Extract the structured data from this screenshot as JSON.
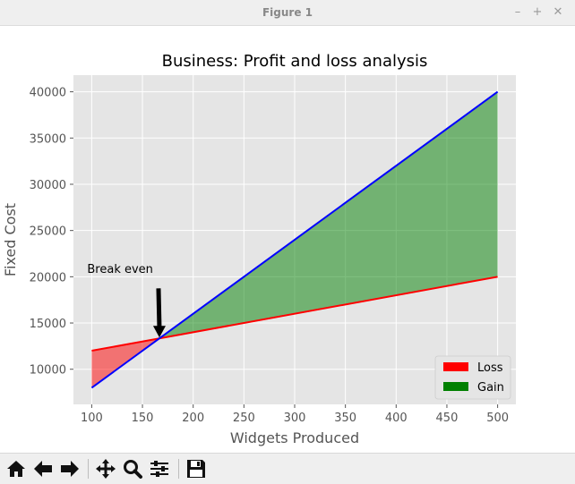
{
  "window": {
    "title": "Figure 1",
    "controls": [
      "minimize",
      "maximize",
      "close"
    ]
  },
  "toolbar": {
    "buttons": [
      {
        "name": "home-button",
        "icon": "home-icon"
      },
      {
        "name": "back-button",
        "icon": "arrow-left-icon"
      },
      {
        "name": "forward-button",
        "icon": "arrow-right-icon"
      },
      {
        "name": "pan-button",
        "icon": "move-icon"
      },
      {
        "name": "zoom-button",
        "icon": "magnifier-icon"
      },
      {
        "name": "configure-subplots-button",
        "icon": "sliders-icon"
      },
      {
        "name": "save-button",
        "icon": "floppy-disk-icon"
      }
    ]
  },
  "chart_data": {
    "type": "line",
    "title": "Business: Profit and loss analysis",
    "xlabel": "Widgets Produced",
    "ylabel": "Fixed Cost",
    "xlim": [
      82,
      518
    ],
    "ylim": [
      6200,
      41800
    ],
    "xticks": [
      100,
      150,
      200,
      250,
      300,
      350,
      400,
      450,
      500
    ],
    "yticks": [
      10000,
      15000,
      20000,
      25000,
      30000,
      35000,
      40000
    ],
    "grid": true,
    "series": [
      {
        "name": "",
        "color": "#ff0000",
        "x": [
          100,
          500
        ],
        "y": [
          12000,
          20000
        ]
      },
      {
        "name": "",
        "color": "#0000ff",
        "x": [
          100,
          500
        ],
        "y": [
          8000,
          40000
        ]
      }
    ],
    "fills": [
      {
        "name": "Loss",
        "color": "#ff0000",
        "x_from": 100,
        "x_to": 166.7
      },
      {
        "name": "Gain",
        "color": "#008000",
        "x_from": 166.7,
        "x_to": 500
      }
    ],
    "legend": {
      "position": "bottom-right",
      "entries": [
        {
          "label": "Loss",
          "color": "#ff0000"
        },
        {
          "label": "Gain",
          "color": "#008000"
        }
      ]
    },
    "annotation": {
      "text": "Break even",
      "point": [
        166.7,
        13333
      ],
      "text_pos": [
        100,
        20500
      ]
    },
    "colors": {
      "background": "#e5e5e5",
      "grid": "#ffffff",
      "tick_text": "#555555"
    }
  }
}
